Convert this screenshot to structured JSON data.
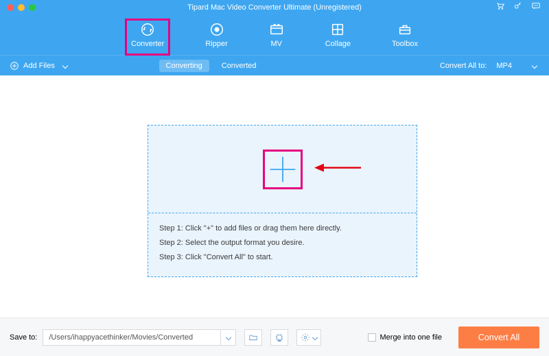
{
  "window": {
    "title": "Tipard Mac Video Converter Ultimate (Unregistered)"
  },
  "tabs": {
    "converter": "Converter",
    "ripper": "Ripper",
    "mv": "MV",
    "collage": "Collage",
    "toolbox": "Toolbox"
  },
  "toolbar": {
    "add_files": "Add Files",
    "converting": "Converting",
    "converted": "Converted",
    "convert_all_to": "Convert All to:",
    "format_selected": "MP4"
  },
  "dropzone": {
    "step1": "Step 1: Click \"+\" to add files or drag them here directly.",
    "step2": "Step 2: Select the output format you desire.",
    "step3": "Step 3: Click \"Convert All\" to start."
  },
  "bottom": {
    "save_to_label": "Save to:",
    "save_path": "/Users/ihappyacethinker/Movies/Converted",
    "merge_label": "Merge into one file",
    "convert_all": "Convert All"
  },
  "colors": {
    "accent": "#3ea6f0",
    "highlight": "#e5007f",
    "cta": "#fd7e45"
  }
}
